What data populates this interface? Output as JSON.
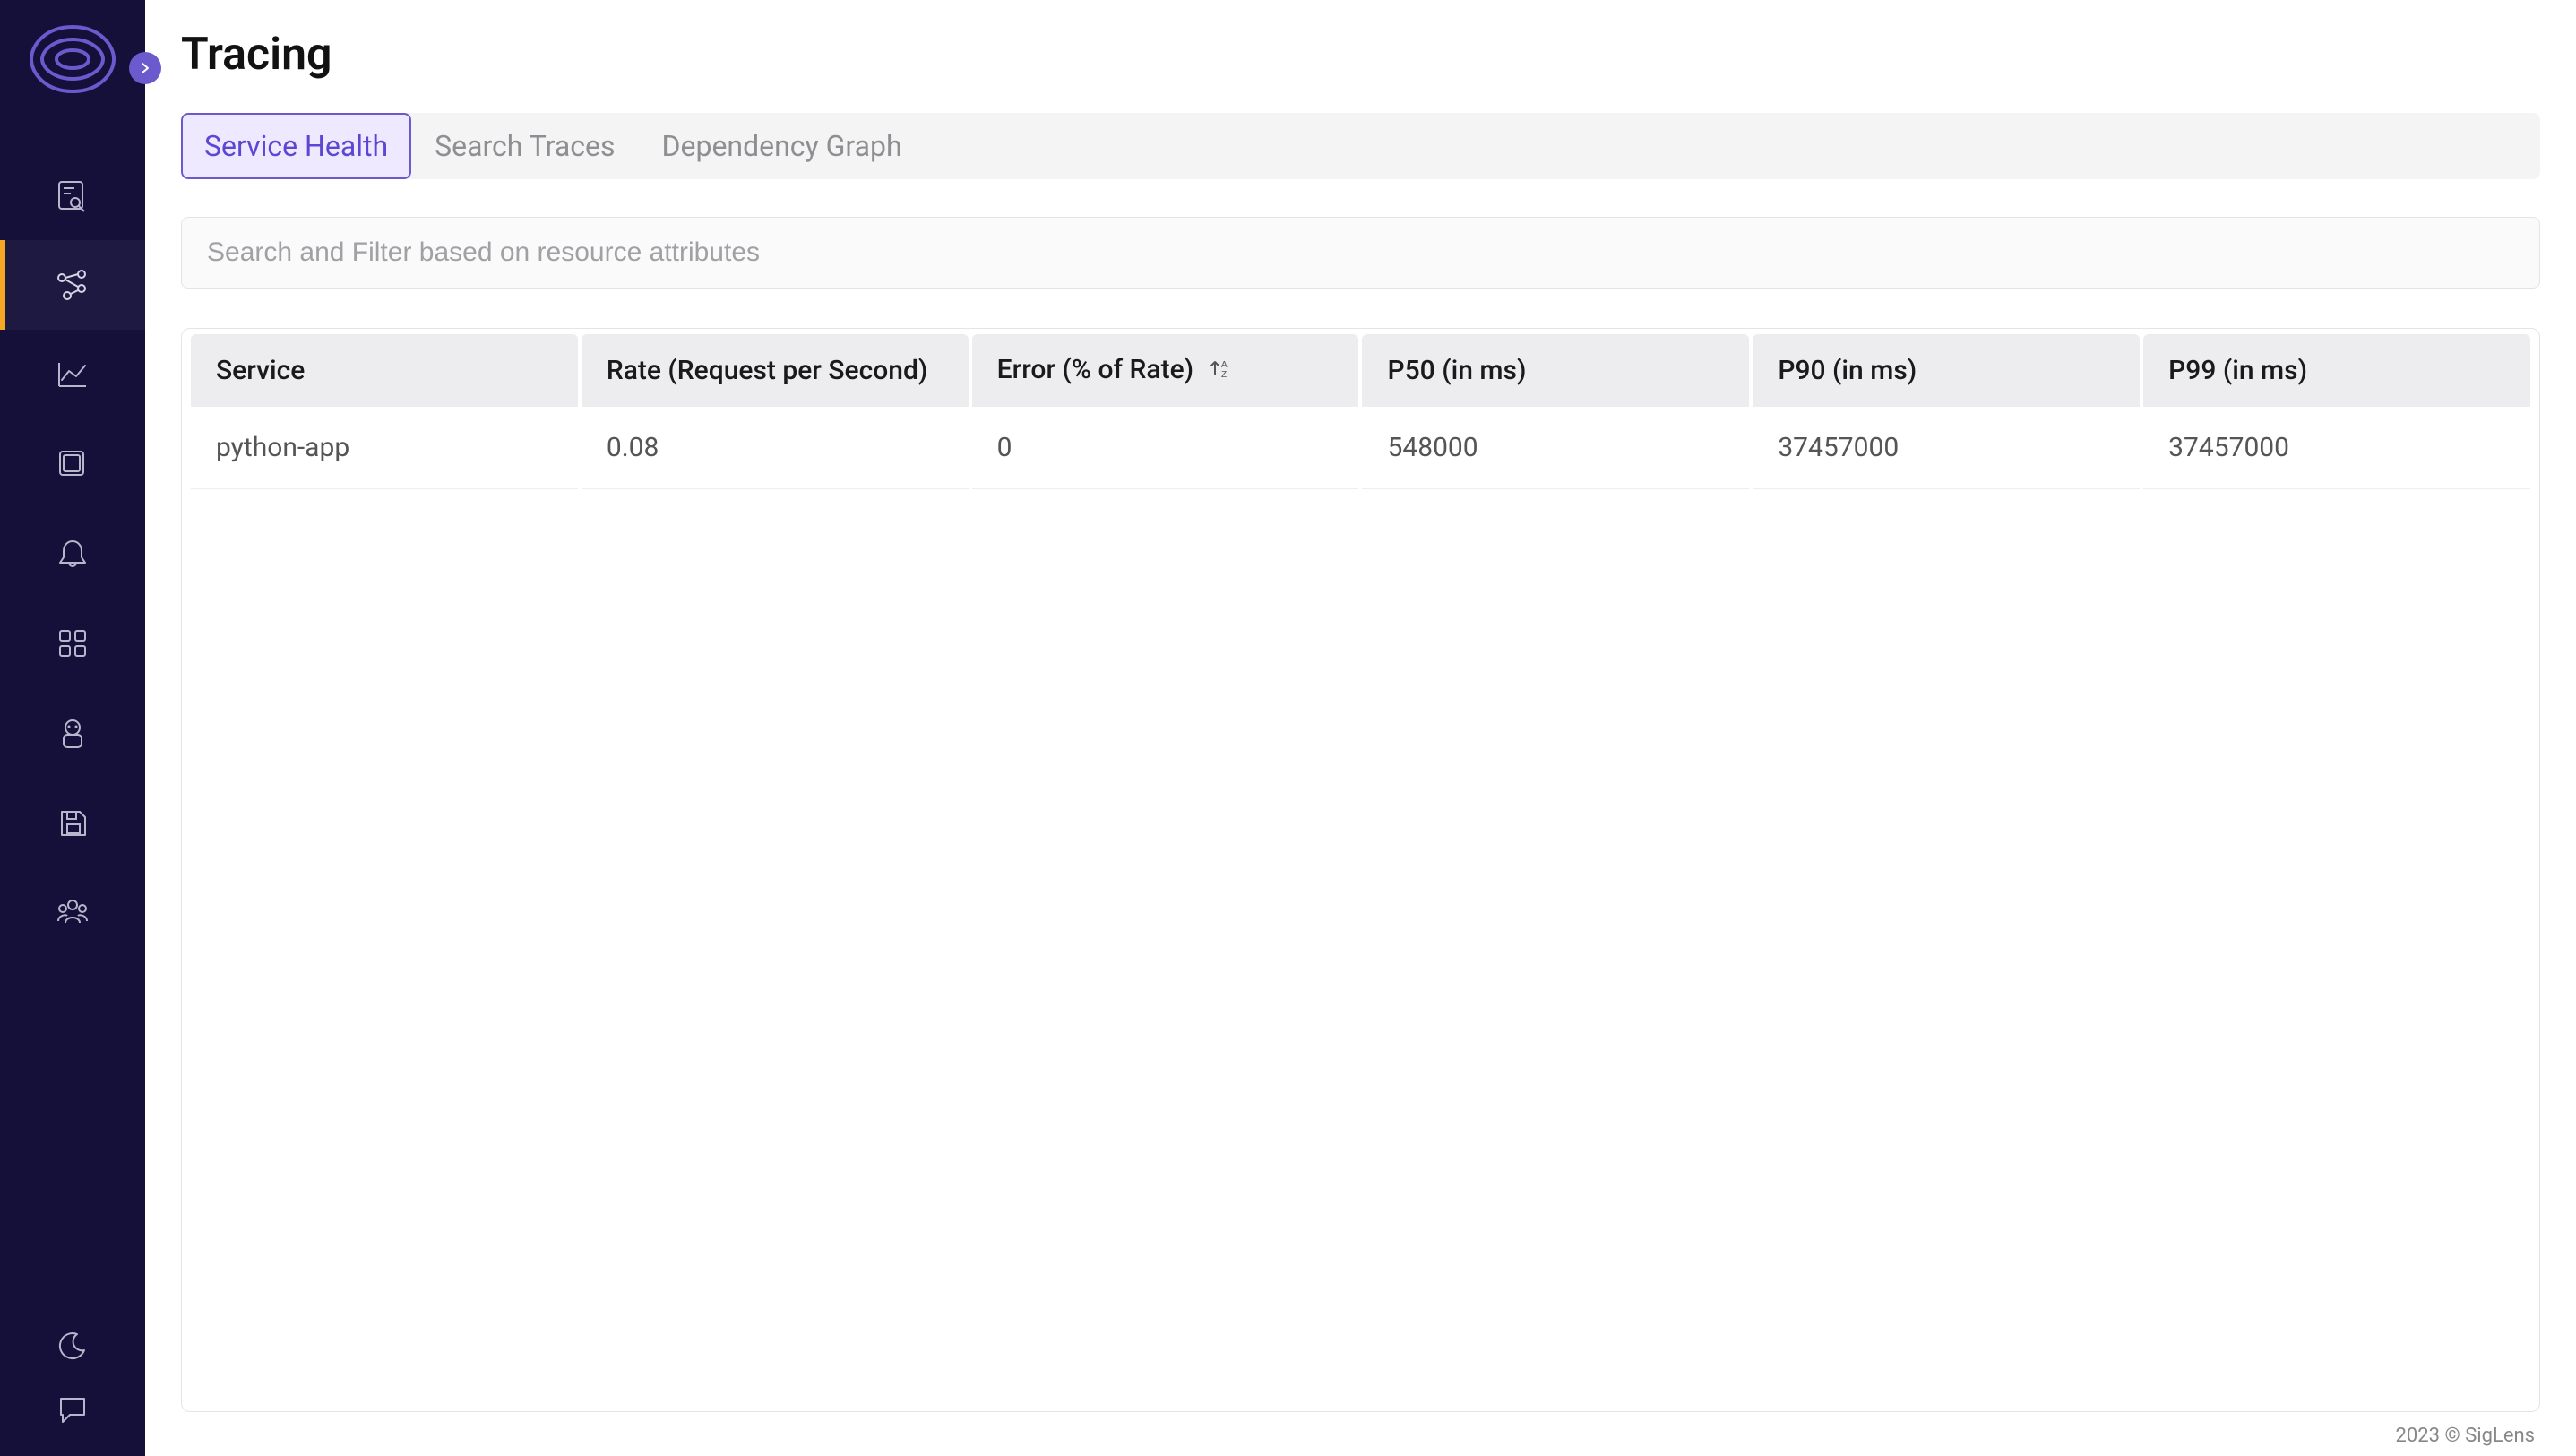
{
  "page": {
    "title": "Tracing"
  },
  "tabs": [
    {
      "label": "Service Health",
      "active": true
    },
    {
      "label": "Search Traces",
      "active": false
    },
    {
      "label": "Dependency Graph",
      "active": false
    }
  ],
  "search": {
    "placeholder": "Search and Filter based on resource attributes",
    "value": ""
  },
  "table": {
    "columns": [
      {
        "label": "Service",
        "sortable": false
      },
      {
        "label": "Rate (Request per Second)",
        "sortable": false
      },
      {
        "label": "Error (% of Rate)",
        "sortable": true
      },
      {
        "label": "P50 (in ms)",
        "sortable": false
      },
      {
        "label": "P90 (in ms)",
        "sortable": false
      },
      {
        "label": "P99 (in ms)",
        "sortable": false
      }
    ],
    "rows": [
      {
        "service": "python-app",
        "rate": "0.08",
        "error": "0",
        "p50": "548000",
        "p90": "37457000",
        "p99": "37457000"
      }
    ]
  },
  "sidebar": {
    "nav": [
      {
        "name": "search",
        "active": false
      },
      {
        "name": "tracing",
        "active": true
      },
      {
        "name": "metrics",
        "active": false
      },
      {
        "name": "dashboards",
        "active": false
      },
      {
        "name": "alerts",
        "active": false
      },
      {
        "name": "apps",
        "active": false
      },
      {
        "name": "bot",
        "active": false
      },
      {
        "name": "save",
        "active": false
      },
      {
        "name": "org",
        "active": false
      }
    ]
  },
  "footer": "2023 © SigLens"
}
